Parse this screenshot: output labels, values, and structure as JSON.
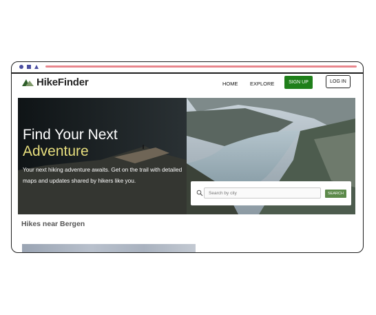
{
  "brand": {
    "name": "HikeFinder",
    "logo_icon": "mountain-icon"
  },
  "nav": {
    "home": "HOME",
    "explore": "EXPLORE",
    "signup": "SIGN UP",
    "login": "LOG IN"
  },
  "hero": {
    "title_line1": "Find Your Next",
    "title_line2": "Adventure",
    "subtitle": "Your next hiking adventure awaits. Get on the trail with detailed maps and updates shared by hikers like you."
  },
  "search": {
    "placeholder": "Search by city",
    "button": "SEARCH",
    "icon": "search-icon"
  },
  "section": {
    "title": "Hikes near Bergen"
  },
  "colors": {
    "accent_green": "#1f7f1a",
    "title_accent": "#e8df7e",
    "browser_dots": "#4b4ea0",
    "url_bar": "#e8868c"
  }
}
